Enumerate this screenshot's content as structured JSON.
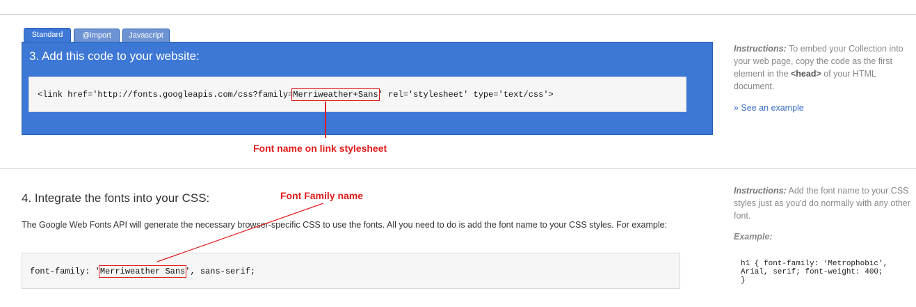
{
  "tabs": [
    {
      "label": "Standard",
      "active": true
    },
    {
      "label": "@import",
      "active": false
    },
    {
      "label": "Javascript",
      "active": false
    }
  ],
  "step3": {
    "title": "3. Add this code to your website:",
    "code_before": "<link href='http://fonts.googleapis.com/css?family=",
    "code_highlight": "Merriweather+Sans",
    "code_after": "' rel='stylesheet' type='text/css'>",
    "annotation": "Font name on link stylesheet"
  },
  "instructions1": {
    "label": "Instructions:",
    "text_part1": " To embed your Collection into your web page, copy the code as the first element in the ",
    "head_tag": "<head>",
    "text_part2": " of your HTML document.",
    "see_example": "» See an example"
  },
  "step4": {
    "title": "4. Integrate the fonts into your CSS:",
    "annotation": "Font Family name",
    "description": "The Google Web Fonts API will generate the necessary browser-specific CSS to use the fonts. All you need to do is add the font name to your CSS styles. For example:",
    "code_before": "font-family: '",
    "code_highlight": "Merriweather Sans",
    "code_after": "', sans-serif;"
  },
  "instructions2": {
    "label": "Instructions:",
    "text": " Add the font name to your CSS styles just as you'd do normally with any other font.",
    "example_label": "Example:",
    "example_code_line1": "h1 { font-family: ‘Metrophobic’,",
    "example_code_line2": "Arial, serif; font-weight: 400;",
    "example_code_line3": "}"
  },
  "colors": {
    "panel_blue": "#3d78d6",
    "annotation_red": "#e01b1b",
    "link_blue": "#3d6fc6"
  }
}
